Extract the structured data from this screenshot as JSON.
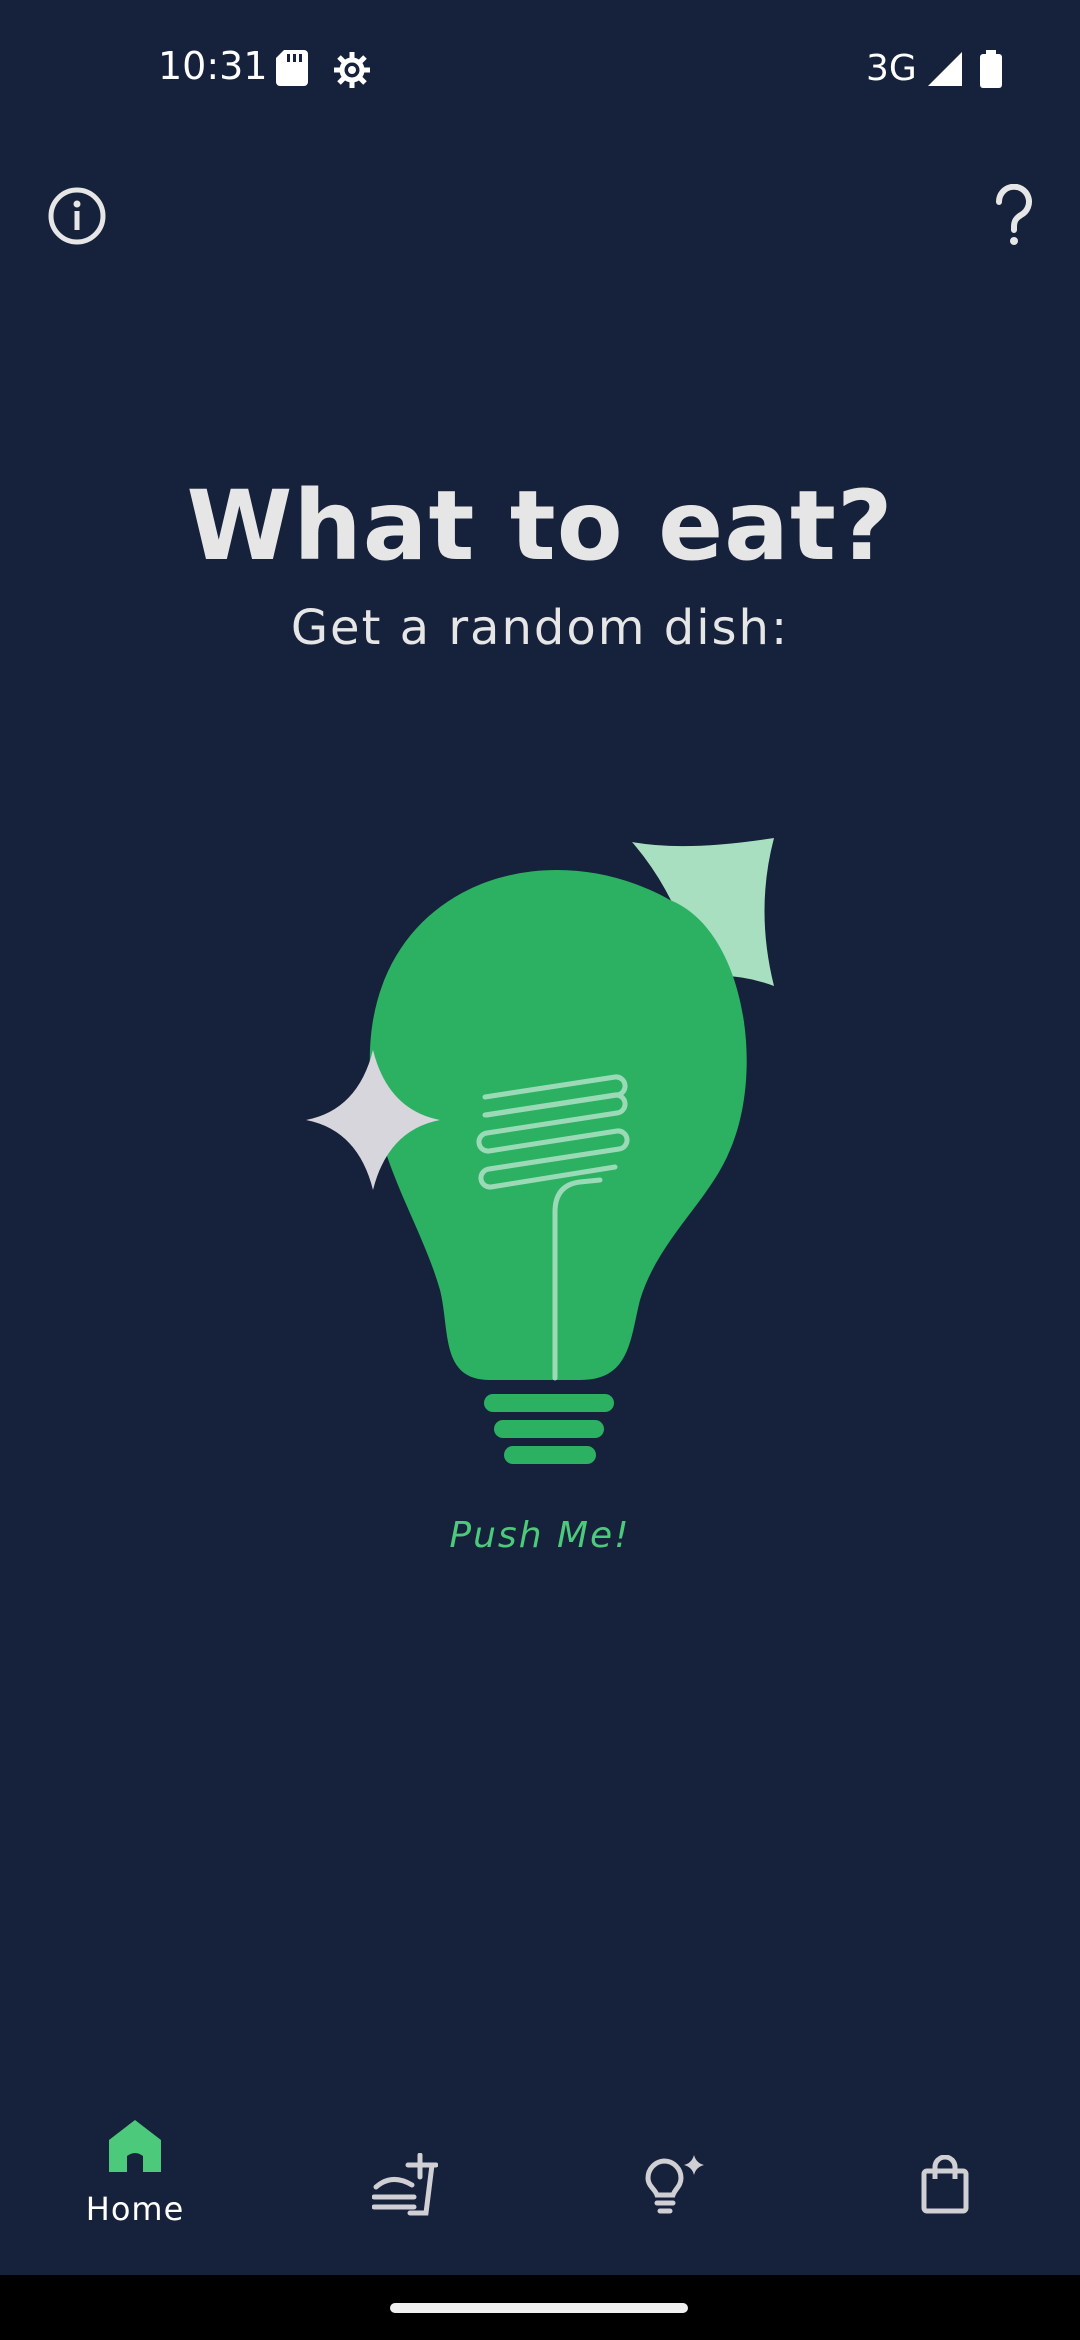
{
  "status_bar": {
    "time": "10:31",
    "network": "3G",
    "icons": [
      "sd-card-icon",
      "settings-gear-icon",
      "signal-icon",
      "battery-icon"
    ]
  },
  "top_bar": {
    "left_icon": "info-icon",
    "right_icon": "help-icon"
  },
  "main": {
    "title": "What to eat?",
    "subtitle": "Get a random dish:",
    "bulb_icon": "lightbulb-icon",
    "push_label": "Push Me!"
  },
  "bottom_nav": {
    "items": [
      {
        "icon": "home-icon",
        "label": "Home",
        "active": true
      },
      {
        "icon": "dish-icon",
        "label": "",
        "active": false
      },
      {
        "icon": "ideas-icon",
        "label": "",
        "active": false
      },
      {
        "icon": "shopping-bag-icon",
        "label": "",
        "active": false
      }
    ]
  },
  "colors": {
    "background": "#16213b",
    "accent": "#4cc97a",
    "bulb_green": "#2bb161",
    "sparkle_mint": "#a8dfc0",
    "sparkle_grey": "#d6d6dc",
    "text": "#e6e6e6"
  }
}
